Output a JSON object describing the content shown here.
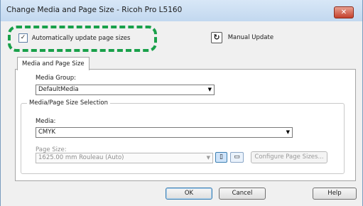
{
  "window": {
    "title": "Change Media and Page Size - Ricoh Pro L5160",
    "close_glyph": "✕"
  },
  "auto_update": {
    "label": "Automatically update page sizes",
    "checked": true,
    "check_glyph": "✓"
  },
  "manual_update": {
    "label": "Manual Update",
    "icon": "refresh-icon",
    "icon_glyph": "↻"
  },
  "tab": {
    "label": "Media and Page Size"
  },
  "media_group": {
    "label": "Media Group:",
    "value": "DefaultMedia"
  },
  "selection_group": {
    "title": "Media/Page Size Selection"
  },
  "media": {
    "label": "Media:",
    "value": "CMYK"
  },
  "page_size": {
    "label": "Page Size:",
    "value": "1625.00 mm Rouleau (Auto)",
    "portrait_icon": "portrait-orientation-icon",
    "landscape_icon": "landscape-orientation-icon",
    "portrait_glyph": "▯",
    "landscape_glyph": "▭"
  },
  "configure_button": {
    "label": "Configure Page Sizes..."
  },
  "footer": {
    "ok": "OK",
    "cancel": "Cancel",
    "help": "Help"
  },
  "dropdown_arrow": "▼",
  "colors": {
    "highlight": "#19a04a",
    "accent": "#3c7fb1",
    "title_bg": "#c2d8ef"
  }
}
